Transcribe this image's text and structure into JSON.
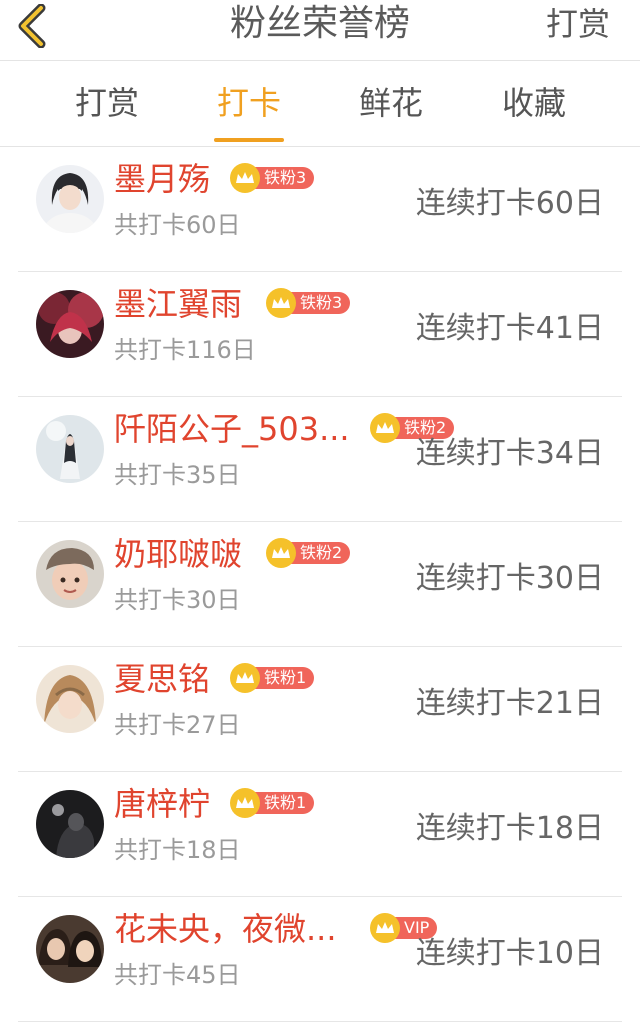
{
  "header": {
    "title": "粉丝荣誉榜",
    "action_label": "打赏",
    "accent_color": "#f0a020"
  },
  "tabs": [
    {
      "label": "打赏",
      "active": false
    },
    {
      "label": "打卡",
      "active": true
    },
    {
      "label": "鲜花",
      "active": false
    },
    {
      "label": "收藏",
      "active": false
    }
  ],
  "fans": [
    {
      "name": "墨月殇",
      "badge": "铁粉3",
      "total": "共打卡60日",
      "streak": "连续打卡60日"
    },
    {
      "name": "墨江翼雨",
      "badge": "铁粉3",
      "total": "共打卡116日",
      "streak": "连续打卡41日"
    },
    {
      "name": "阡陌公子_503...",
      "badge": "铁粉2",
      "total": "共打卡35日",
      "streak": "连续打卡34日"
    },
    {
      "name": "奶耶啵啵",
      "badge": "铁粉2",
      "total": "共打卡30日",
      "streak": "连续打卡30日"
    },
    {
      "name": "夏思铭",
      "badge": "铁粉1",
      "total": "共打卡27日",
      "streak": "连续打卡21日"
    },
    {
      "name": "唐梓柠",
      "badge": "铁粉1",
      "total": "共打卡18日",
      "streak": "连续打卡18日"
    },
    {
      "name": "花未央，夜微...",
      "badge": "VIP",
      "total": "共打卡45日",
      "streak": "连续打卡10日"
    }
  ]
}
